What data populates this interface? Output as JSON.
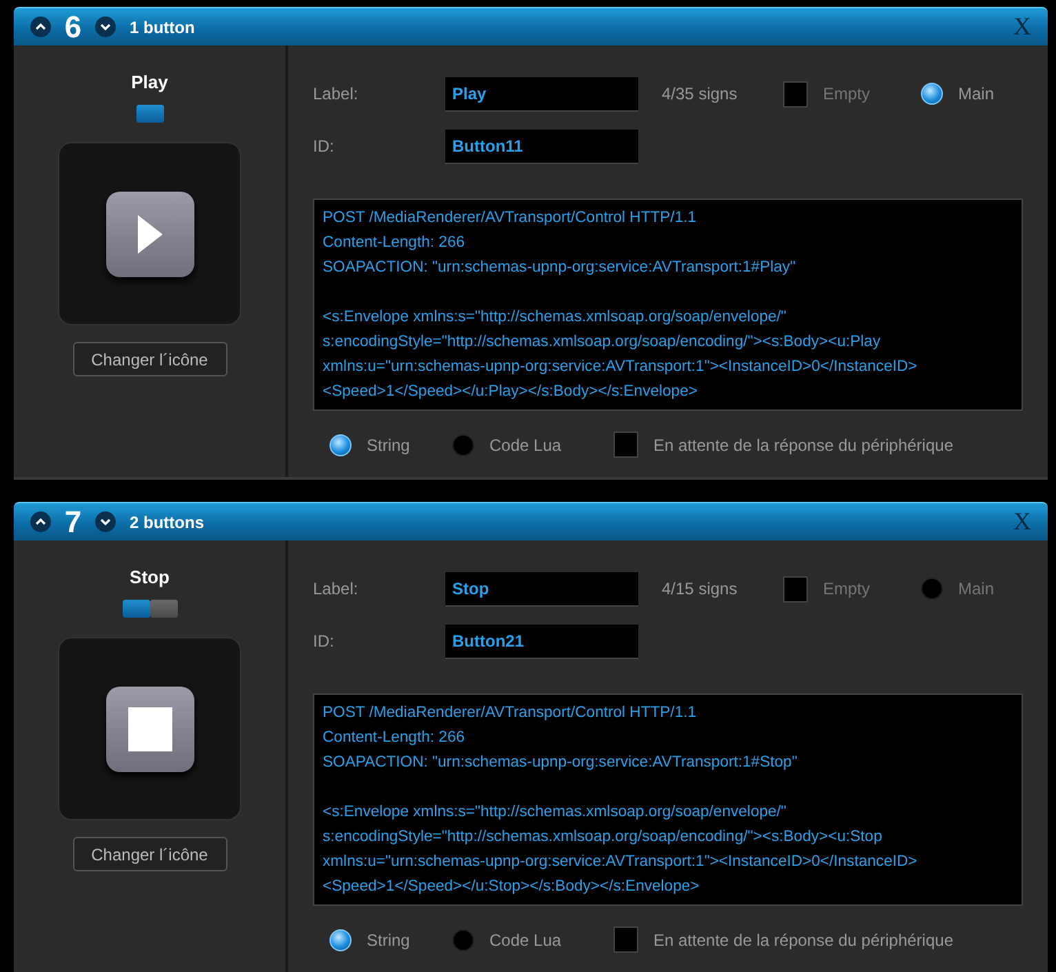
{
  "panels": [
    {
      "number": "6",
      "title": "1 button",
      "close": "X",
      "preview": {
        "name": "Play",
        "kind": "play",
        "slots": [
          {
            "selected": true
          }
        ]
      },
      "change_icon": "Changer l´icône",
      "label_field": {
        "label": "Label:",
        "value": "Play",
        "counter": "4/35 signs"
      },
      "id_field": {
        "label": "ID:",
        "value": "Button11"
      },
      "empty": {
        "label": "Empty",
        "checked": false
      },
      "main": {
        "label": "Main",
        "selected": true
      },
      "request": {
        "headers": [
          "POST /MediaRenderer/AVTransport/Control HTTP/1.1",
          "Content-Length: 266",
          "SOAPACTION: \"urn:schemas-upnp-org:service:AVTransport:1#Play\""
        ],
        "body": [
          "<s:Envelope xmlns:s=\"http://schemas.xmlsoap.org/soap/envelope/\"",
          "s:encodingStyle=\"http://schemas.xmlsoap.org/soap/encoding/\"><s:Body><u:Play",
          "xmlns:u=\"urn:schemas-upnp-org:service:AVTransport:1\"><InstanceID>0</InstanceID>",
          "<Speed>1</Speed></u:Play></s:Body></s:Envelope>"
        ]
      },
      "modes": [
        {
          "label": "String",
          "selected": true
        },
        {
          "label": "Code Lua",
          "selected": false
        }
      ],
      "wait": {
        "label": "En attente de la réponse du périphérique",
        "checked": false
      }
    },
    {
      "number": "7",
      "title": "2 buttons",
      "close": "X",
      "preview": {
        "name": "Stop",
        "kind": "stop",
        "slots": [
          {
            "selected": true
          },
          {
            "selected": false
          }
        ]
      },
      "change_icon": "Changer l´icône",
      "label_field": {
        "label": "Label:",
        "value": "Stop",
        "counter": "4/15 signs"
      },
      "id_field": {
        "label": "ID:",
        "value": "Button21"
      },
      "empty": {
        "label": "Empty",
        "checked": false
      },
      "main": {
        "label": "Main",
        "selected": false
      },
      "request": {
        "headers": [
          "POST /MediaRenderer/AVTransport/Control HTTP/1.1",
          "Content-Length: 266",
          "SOAPACTION: \"urn:schemas-upnp-org:service:AVTransport:1#Stop\""
        ],
        "body": [
          "<s:Envelope xmlns:s=\"http://schemas.xmlsoap.org/soap/envelope/\"",
          "s:encodingStyle=\"http://schemas.xmlsoap.org/soap/encoding/\"><s:Body><u:Stop",
          "xmlns:u=\"urn:schemas-upnp-org:service:AVTransport:1\"><InstanceID>0</InstanceID>",
          "<Speed>1</Speed></u:Stop></s:Body></s:Envelope>"
        ]
      },
      "modes": [
        {
          "label": "String",
          "selected": true
        },
        {
          "label": "Code Lua",
          "selected": false
        }
      ],
      "wait": {
        "label": "En attente de la réponse du périphérique",
        "checked": false
      }
    }
  ]
}
